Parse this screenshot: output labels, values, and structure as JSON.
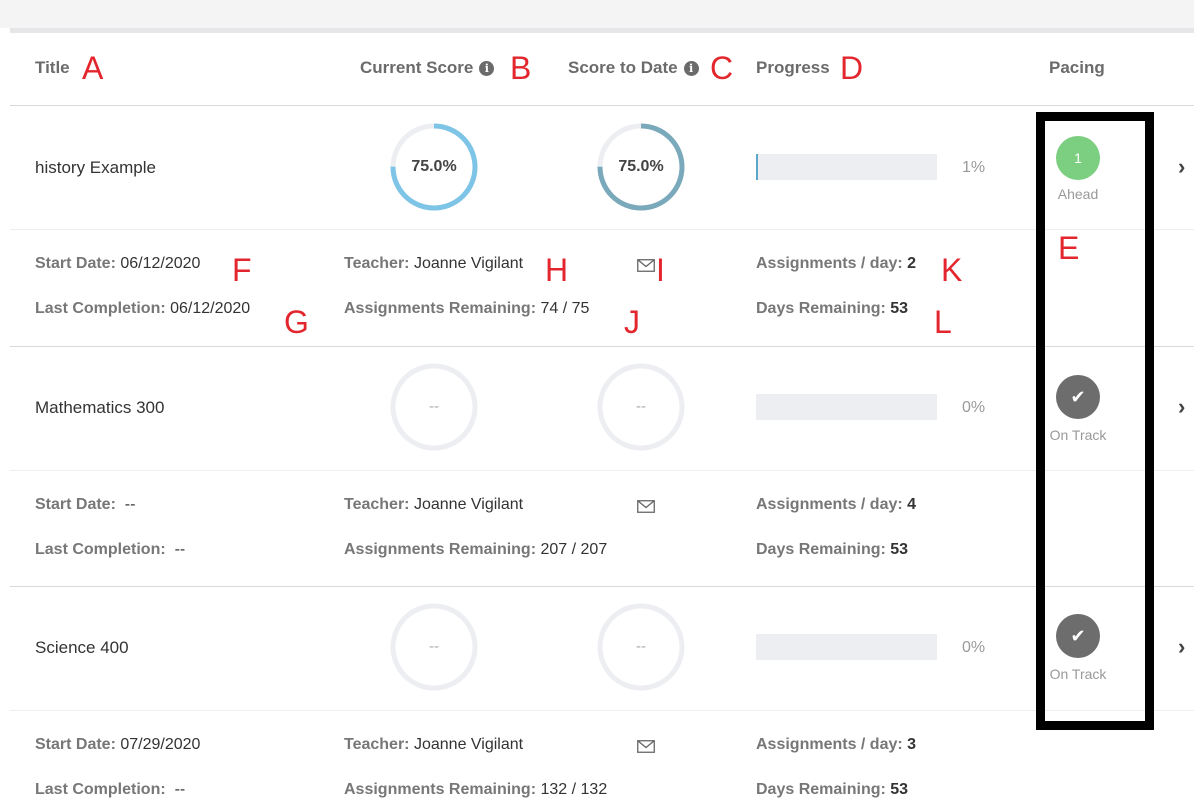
{
  "columns": {
    "title": "Title",
    "current_score": "Current Score",
    "score_to_date": "Score to Date",
    "progress": "Progress",
    "pacing": "Pacing",
    "info_icon": "info-icon"
  },
  "annotations": [
    "A",
    "B",
    "C",
    "D",
    "E",
    "F",
    "G",
    "H",
    "I",
    "J",
    "K",
    "L"
  ],
  "labels": {
    "start_date": "Start Date:",
    "last_completion": "Last Completion:",
    "teacher": "Teacher:",
    "assignments_remaining": "Assignments Remaining:",
    "assignments_per_day": "Assignments / day:",
    "days_remaining": "Days Remaining:"
  },
  "courses": [
    {
      "title": "history Example",
      "current_score": "75.0%",
      "current_score_value": 0.75,
      "score_to_date": "75.0%",
      "score_to_date_value": 0.75,
      "progress": "1%",
      "progress_value": 0.01,
      "pacing_badge": "1",
      "pacing_label": "Ahead",
      "start_date": "06/12/2020",
      "last_completion": "06/12/2020",
      "teacher": "Joanne Vigilant",
      "assignments_remaining": "74 / 75",
      "assignments_per_day": "2",
      "days_remaining": "53"
    },
    {
      "title": "Mathematics 300",
      "current_score": "--",
      "score_to_date": "--",
      "progress": "0%",
      "progress_value": 0,
      "pacing_badge": "✔",
      "pacing_label": "On Track",
      "start_date": "--",
      "last_completion": "--",
      "teacher": "Joanne Vigilant",
      "assignments_remaining": "207 / 207",
      "assignments_per_day": "4",
      "days_remaining": "53"
    },
    {
      "title": "Science 400",
      "current_score": "--",
      "score_to_date": "--",
      "progress": "0%",
      "progress_value": 0,
      "pacing_badge": "✔",
      "pacing_label": "On Track",
      "start_date": "07/29/2020",
      "last_completion": "--",
      "teacher": "Joanne Vigilant",
      "assignments_remaining": "132 / 132",
      "assignments_per_day": "3",
      "days_remaining": "53"
    }
  ],
  "colors": {
    "current_score_ring": "#7ec4e6",
    "score_to_date_ring": "#7aa9bb",
    "empty_ring": "#eceef2",
    "progress_fill": "#5aa8c9",
    "ahead_badge": "#7ccf80",
    "on_track_badge": "#6d6d6d",
    "annotation": "#e3262d"
  }
}
